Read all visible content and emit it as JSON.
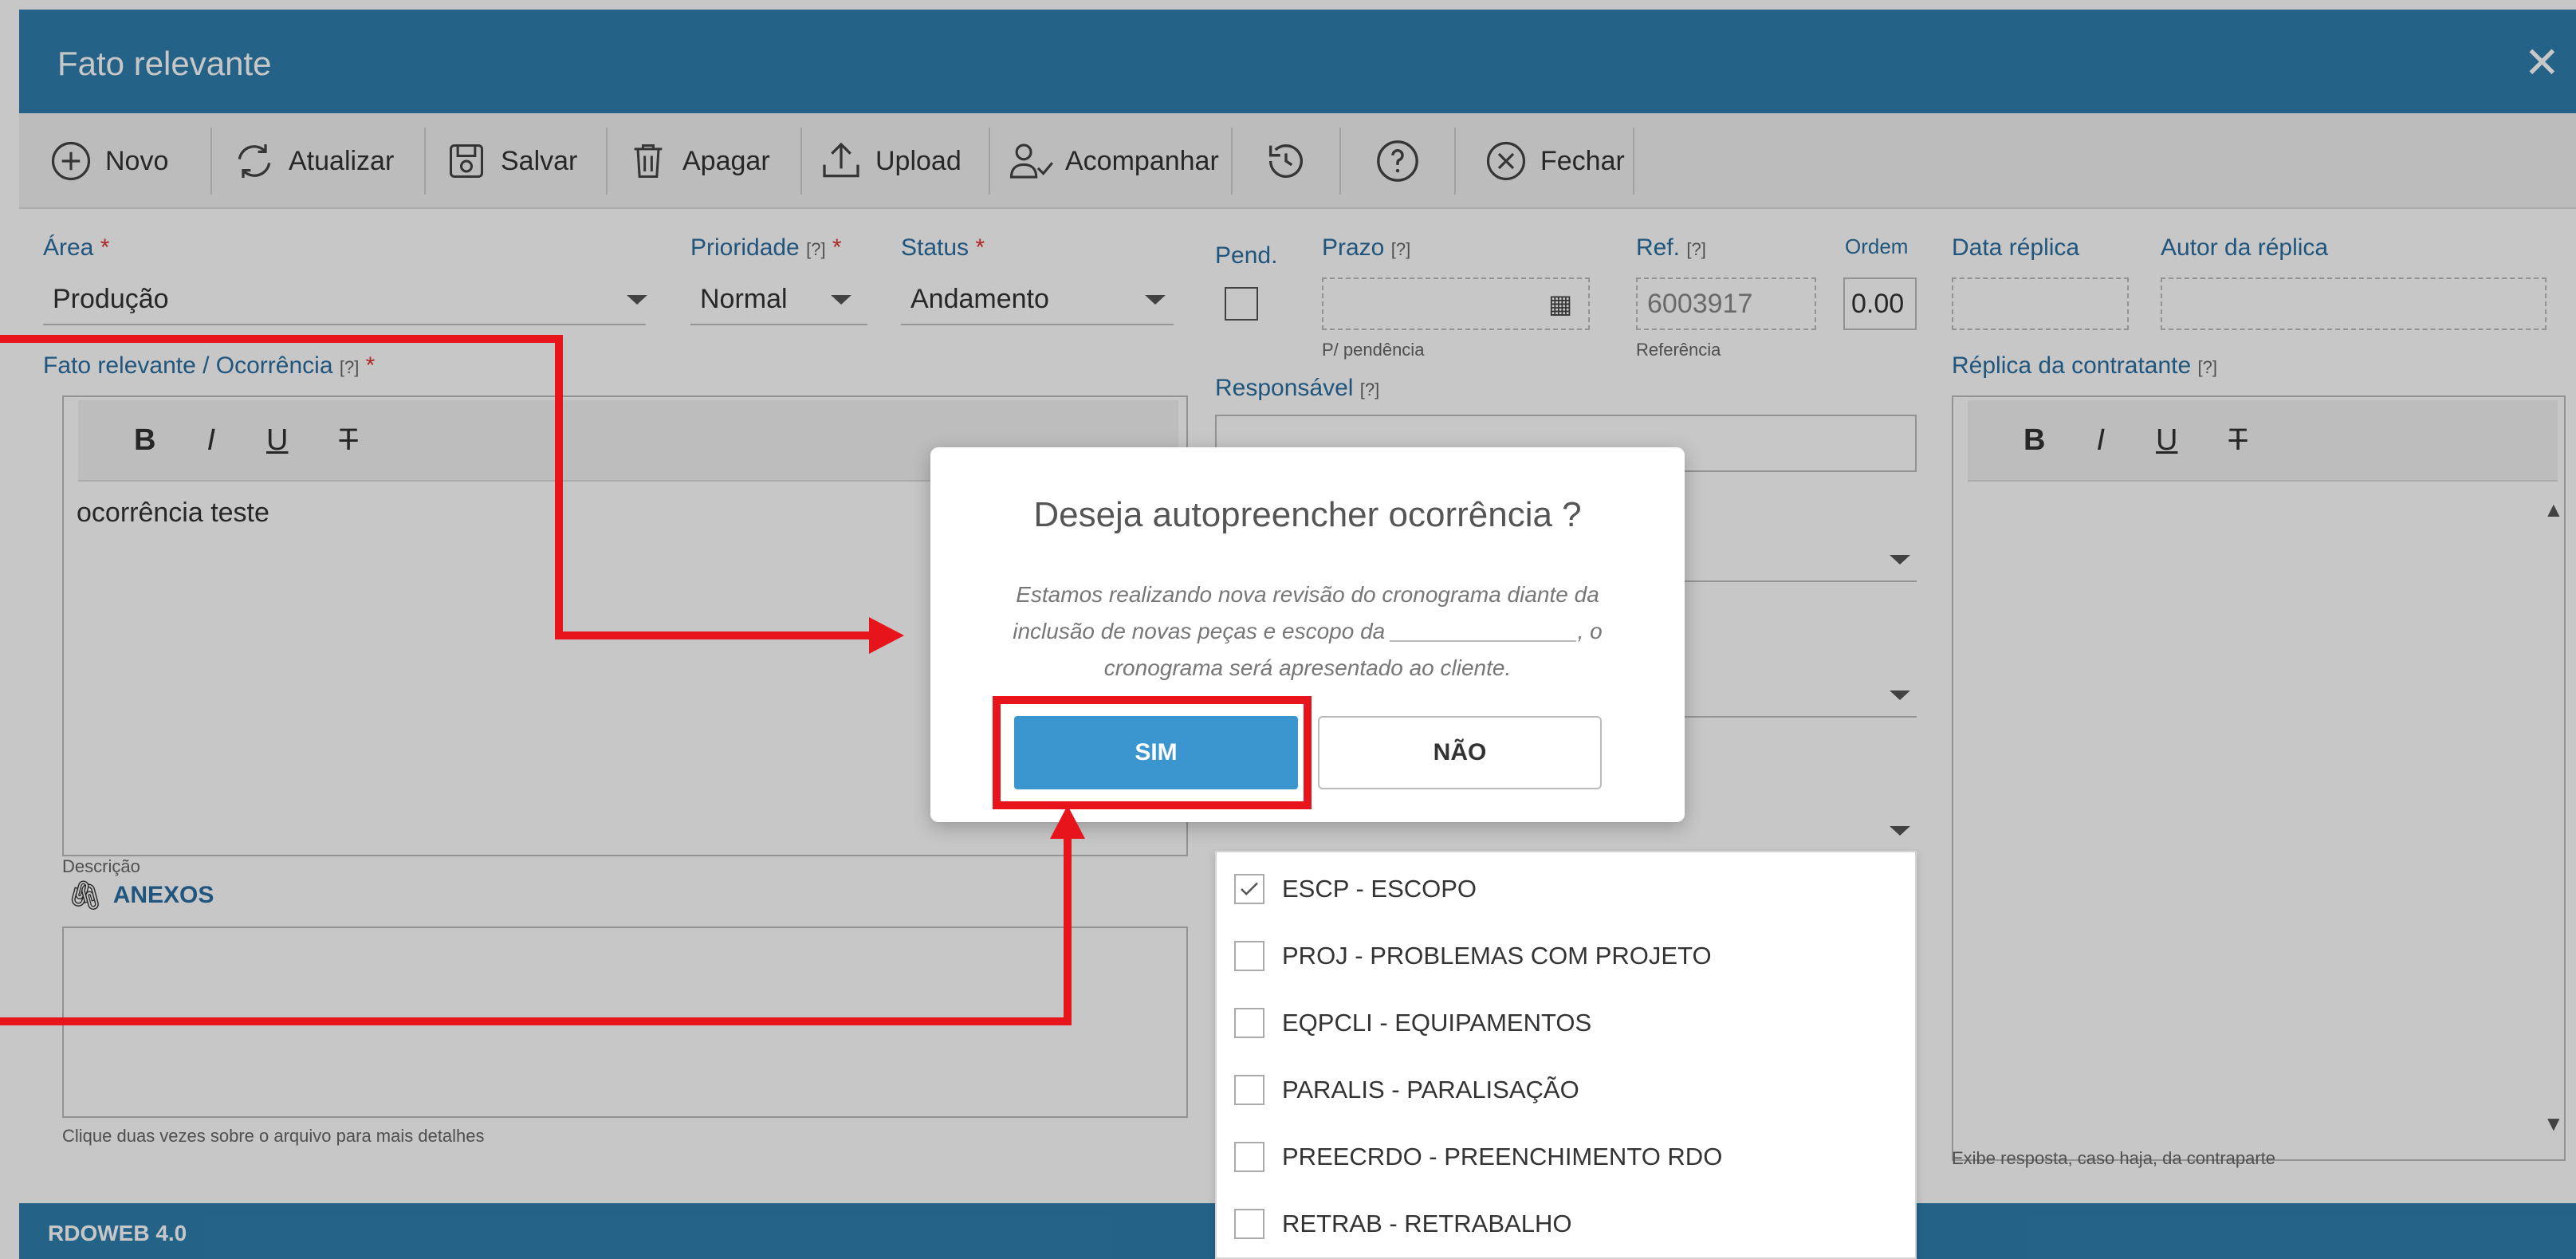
{
  "window": {
    "title": "Fato relevante",
    "close_icon": "close-icon"
  },
  "toolbar": {
    "novo": "Novo",
    "atualizar": "Atualizar",
    "salvar": "Salvar",
    "apagar": "Apagar",
    "upload": "Upload",
    "acompanhar": "Acompanhar",
    "fechar": "Fechar"
  },
  "form": {
    "area_label": "Área",
    "area_value": "Produção",
    "prioridade_label": "Prioridade",
    "prioridade_value": "Normal",
    "status_label": "Status",
    "status_value": "Andamento",
    "pend_label": "Pend.",
    "prazo_label": "Prazo",
    "prazo_hint": "P/ pendência",
    "ref_label": "Ref.",
    "ref_value": "6003917",
    "ref_hint": "Referência",
    "ordem_label": "Ordem",
    "ordem_value": "0.00",
    "data_replica_label": "Data réplica",
    "autor_replica_label": "Autor da réplica",
    "fato_label": "Fato relevante / Ocorrência",
    "fato_text": "ocorrência teste",
    "descricao_hint": "Descrição",
    "responsavel_label": "Responsável",
    "replica_label": "Réplica da contratante",
    "replica_hint": "Exibe resposta, caso haja, da contraparte",
    "anexos_label": "ANEXOS",
    "anexos_hint": "Clique duas vezes sobre o arquivo para mais detalhes",
    "required_mark": "*",
    "help_mark": "[?]"
  },
  "rte": {
    "bold": "B",
    "italic": "I",
    "underline": "U",
    "clear": "T"
  },
  "dropdown": {
    "items": [
      {
        "label": "ESCP - ESCOPO",
        "checked": true
      },
      {
        "label": "PROJ - PROBLEMAS COM PROJETO",
        "checked": false
      },
      {
        "label": "EQPCLI - EQUIPAMENTOS",
        "checked": false
      },
      {
        "label": "PARALIS - PARALISAÇÃO",
        "checked": false
      },
      {
        "label": "PREECRDO - PREENCHIMENTO RDO",
        "checked": false
      },
      {
        "label": "RETRAB - RETRABALHO",
        "checked": false
      }
    ]
  },
  "modal": {
    "title": "Deseja autopreencher ocorrência ?",
    "text": "Estamos realizando nova revisão do cronograma diante da inclusão de novas peças e escopo da _______________, o cronograma será apresentado ao cliente.",
    "yes": "SIM",
    "no": "NÃO"
  },
  "footer": {
    "text": "RDOWEB 4.0"
  },
  "colors": {
    "header": "#2f7fae",
    "primary_button": "#3b96cf",
    "annotation": "#e8141b",
    "label": "#2a6ea0"
  }
}
